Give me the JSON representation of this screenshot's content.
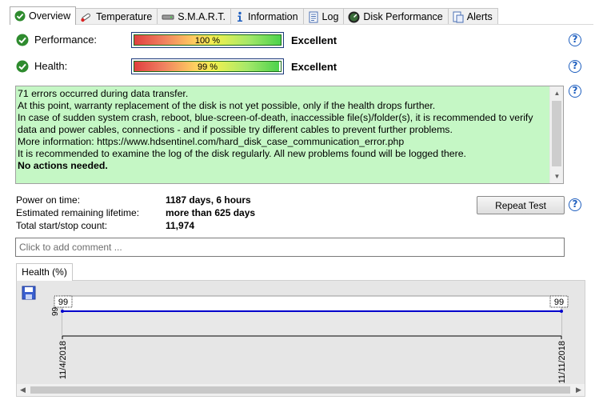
{
  "tabs": [
    {
      "label": "Overview",
      "icon": "check-circle-icon"
    },
    {
      "label": "Temperature",
      "icon": "thermometer-icon"
    },
    {
      "label": "S.M.A.R.T.",
      "icon": "drive-icon"
    },
    {
      "label": "Information",
      "icon": "info-icon"
    },
    {
      "label": "Log",
      "icon": "log-icon"
    },
    {
      "label": "Disk Performance",
      "icon": "gauge-icon"
    },
    {
      "label": "Alerts",
      "icon": "alert-doc-icon"
    }
  ],
  "performance": {
    "label": "Performance:",
    "value": 1.0,
    "bar_text": "100 %",
    "status": "Excellent"
  },
  "health": {
    "label": "Health:",
    "value": 0.99,
    "bar_text": "99 %",
    "status": "Excellent"
  },
  "help_glyph": "?",
  "message": {
    "text": "71 errors occurred during data transfer.\nAt this point, warranty replacement of the disk is not yet possible, only if the health drops further.\nIn case of sudden system crash, reboot, blue-screen-of-death, inaccessible file(s)/folder(s), it is recommended to verify data and power cables, connections - and if possible try different cables to prevent further problems.\nMore information: https://www.hdsentinel.com/hard_disk_case_communication_error.php\nIt is recommended to examine the log of the disk regularly. All new problems found will be logged there.\n",
    "bold": "No actions needed."
  },
  "info": {
    "power_on_label": "Power on time:",
    "power_on_value": "1187 days, 6 hours",
    "lifetime_label": "Estimated remaining lifetime:",
    "lifetime_value": "more than 625 days",
    "startstop_label": "Total start/stop count:",
    "startstop_value": "11,974"
  },
  "repeat_test_label": "Repeat Test",
  "comment_placeholder": "Click to add comment ...",
  "graph_tab_label": "Health (%)",
  "colors": {
    "message_bg": "#c5f7c5",
    "line": "#0000cc",
    "help": "#1f5fbf"
  },
  "chart_data": {
    "type": "line",
    "x": [
      "11/4/2018",
      "11/11/2018"
    ],
    "series": [
      {
        "values": [
          99,
          99
        ]
      }
    ],
    "data_labels": [
      "99",
      "99"
    ],
    "y_tick_labels": [
      "99"
    ],
    "grid": false
  }
}
